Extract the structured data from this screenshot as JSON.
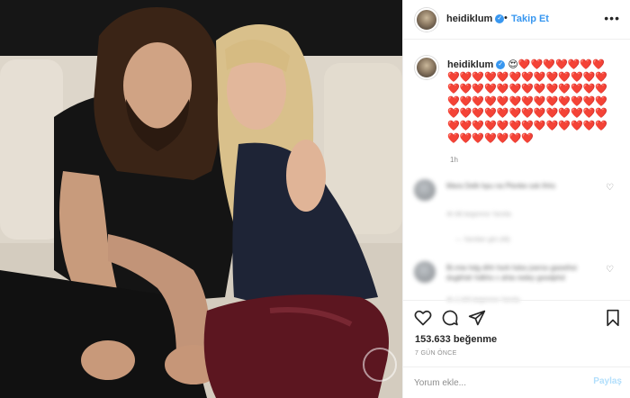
{
  "header": {
    "username": "heidiklum",
    "separator": "•",
    "follow_label": "Takip Et",
    "more_label": "•••"
  },
  "caption": {
    "username": "heidiklum",
    "emoji_text": "😍❤️❤️❤️❤️❤️❤️❤️❤️❤️❤️❤️❤️❤️❤️❤️❤️❤️❤️❤️❤️❤️❤️❤️❤️❤️❤️❤️❤️❤️❤️❤️❤️❤️❤️❤️❤️❤️❤️❤️❤️❤️❤️❤️❤️❤️❤️❤️❤️❤️❤️❤️❤️❤️❤️❤️❤️❤️❤️❤️❤️❤️❤️❤️❤️❤️❤️❤️❤️❤️❤️❤️❤️❤️❤️❤️❤️❤️❤️❤️",
    "time_ago": "1h"
  },
  "comments": [
    {
      "text": "Mara Delk hpu na Plonke ssk lhhs",
      "meta": "4h   88 begenme   Yanıtla",
      "replies": "—   Yanıtları gör (48)"
    },
    {
      "text": "Bi.mia hdg dhh hsrk hdss joerss gaseihsi dugkhdr hdkhs c ahia redey goodphd",
      "meta": "4h   2.345 begenme   Yanıtla"
    }
  ],
  "actions": {
    "like_icon": "heart-icon",
    "comment_icon": "comment-icon",
    "share_icon": "share-icon",
    "save_icon": "bookmark-icon",
    "likes_text": "153.633 beğenme",
    "date_text": "7 GÜN ÖNCE"
  },
  "comment_bar": {
    "placeholder": "Yorum ekle...",
    "post_label": "Paylaş"
  },
  "colors": {
    "accent": "#3897f0",
    "heart": "#ed4956",
    "muted": "#8e8e8e"
  }
}
